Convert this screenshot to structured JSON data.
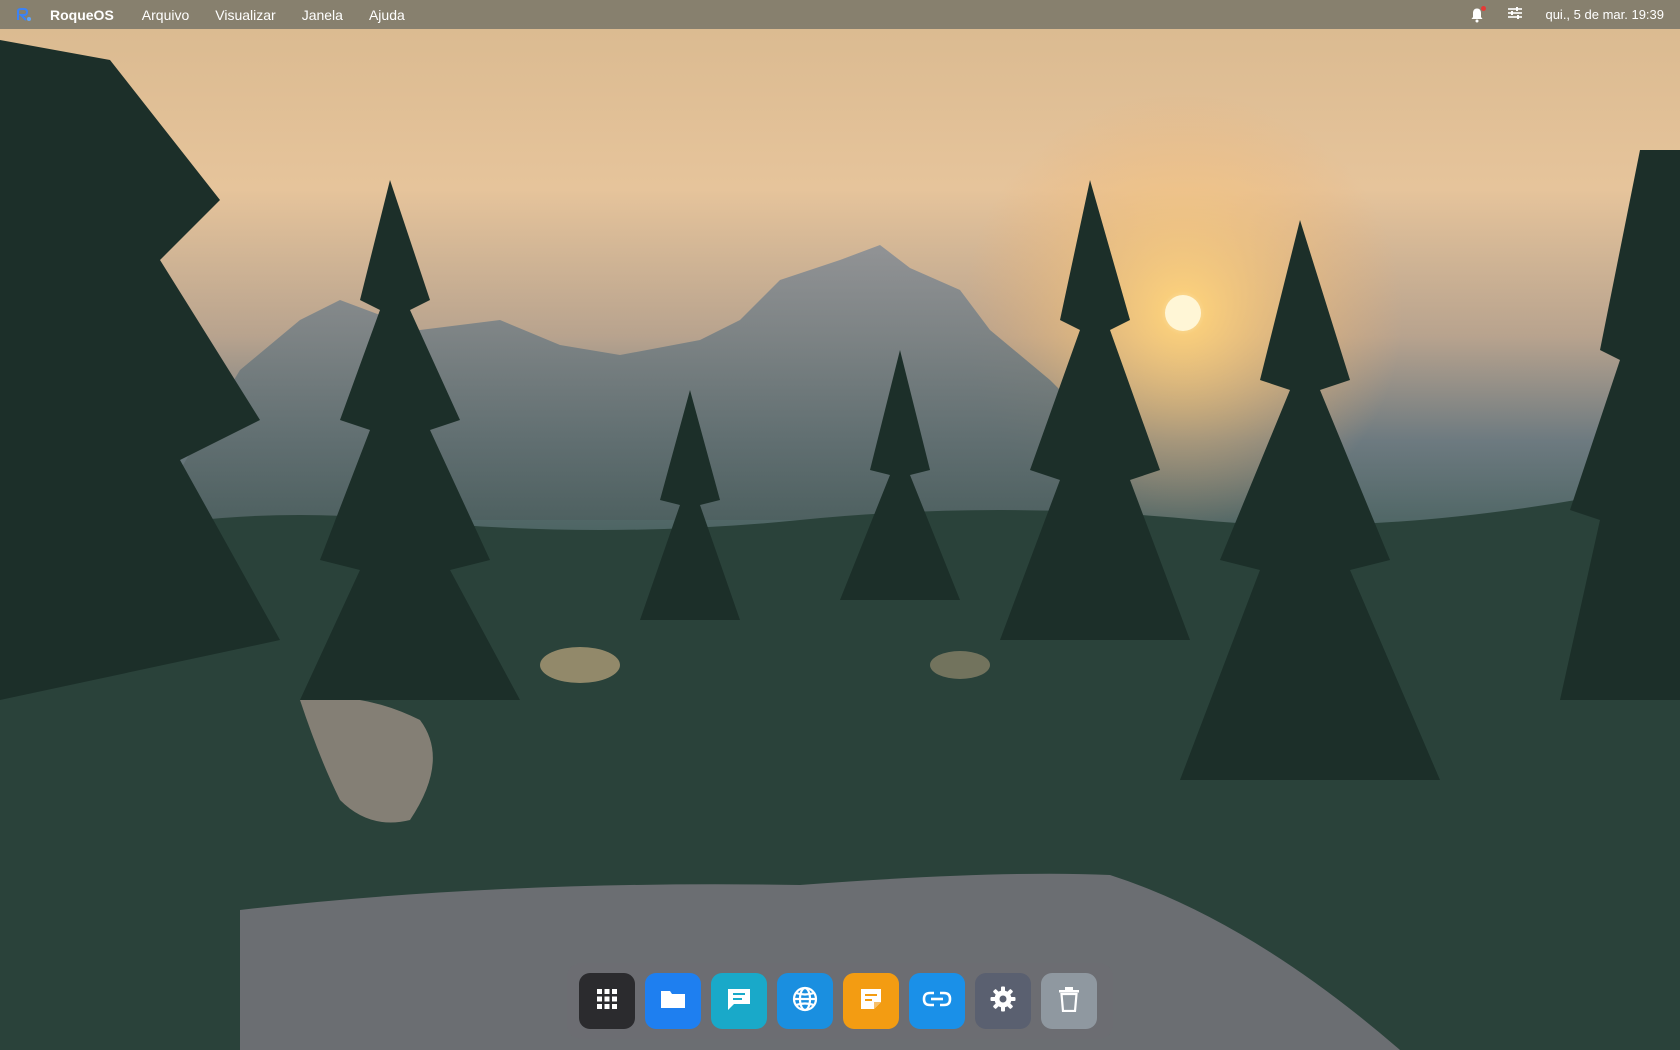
{
  "menubar": {
    "app_name": "RoqueOS",
    "menus": [
      {
        "label": "Arquivo"
      },
      {
        "label": "Visualizar"
      },
      {
        "label": "Janela"
      },
      {
        "label": "Ajuda"
      }
    ],
    "clock": "qui., 5 de mar. 19:39",
    "icons": {
      "logo": "roqueos-logo",
      "notifications": "bell-icon",
      "settings": "sliders-icon"
    }
  },
  "dock": {
    "items": [
      {
        "name": "apps-grid",
        "icon": "grid-icon",
        "color": "#2b2b2e"
      },
      {
        "name": "files",
        "icon": "folder-icon",
        "color": "#1e7ff0"
      },
      {
        "name": "messages",
        "icon": "chat-icon",
        "color": "#19a9c9"
      },
      {
        "name": "browser",
        "icon": "globe-icon",
        "color": "#1a8fe0"
      },
      {
        "name": "notes",
        "icon": "note-icon",
        "color": "#f39c12"
      },
      {
        "name": "links",
        "icon": "link-icon",
        "color": "#1a90e8"
      },
      {
        "name": "settings",
        "icon": "gear-icon",
        "color": "#5a6070"
      },
      {
        "name": "trash",
        "icon": "trash-icon",
        "color": "#8f98a0"
      }
    ]
  }
}
